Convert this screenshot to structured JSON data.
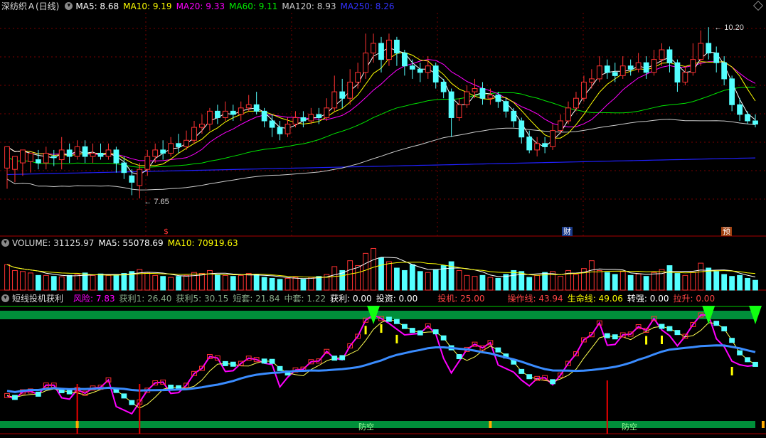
{
  "main_header": {
    "stock": "深纺织Ａ(日线)",
    "ma5": "MA5: 8.68",
    "ma10": "MA10: 9.19",
    "ma20": "MA20: 9.33",
    "ma60": "MA60: 9.11",
    "ma120": "MA120: 8.93",
    "ma250": "MA250: 8.26"
  },
  "vol_header": {
    "vol": "VOLUME: 31125.97",
    "ma5": "MA5: 55078.69",
    "ma10": "MA10: 70919.63"
  },
  "ind_header": {
    "name": "短线投机获利",
    "risk": "风险: 7.83",
    "p1": "获利1: 26.40",
    "p5": "获利5: 30.15",
    "short": "短套: 21.84",
    "mid": "中套: 1.22",
    "profit": "获利: 0.00",
    "invest": "投资: 0.00",
    "spec": "投机: 25.00",
    "op": "操作线: 43.94",
    "life": "生命线: 49.06",
    "turn": "转强: 0.00",
    "pull": "拉升: 0.00"
  },
  "markers": {
    "s": "$",
    "cai": "财",
    "yu": "预"
  },
  "bottom_labels": {
    "l1": "防空",
    "l2": "防空"
  },
  "colors": {
    "up": "#ff3232",
    "down": "#54ffff",
    "ma5": "#ffffff",
    "ma10": "#ffff00",
    "ma20": "#ff00ff",
    "ma60": "#00e600",
    "ma120": "#cccccc",
    "ma250": "#2020ff",
    "op": "#ffff50",
    "life": "#3a8cff",
    "risk": "#ff00ff",
    "green_bar": "#008f3a"
  },
  "chart_data": {
    "type": "candlestick",
    "ylim": [
      7.2,
      10.5
    ],
    "high_label": "10.20",
    "low_label": "7.65",
    "candles": [
      [
        8.12,
        8.45,
        8.35,
        7.8
      ],
      [
        8.1,
        8.3,
        8.2,
        7.9
      ],
      [
        8.2,
        8.4,
        8.3,
        8.0
      ],
      [
        8.22,
        8.35,
        8.3,
        8.05
      ],
      [
        8.25,
        8.2,
        8.4,
        8.1
      ],
      [
        8.2,
        8.35,
        8.45,
        8.1
      ],
      [
        8.3,
        8.28,
        8.4,
        8.15
      ],
      [
        8.25,
        8.4,
        8.6,
        8.1
      ],
      [
        8.4,
        8.3,
        8.5,
        8.2
      ],
      [
        8.3,
        8.45,
        8.55,
        8.25
      ],
      [
        8.45,
        8.3,
        8.55,
        8.2
      ],
      [
        8.3,
        8.35,
        8.5,
        8.2
      ],
      [
        8.35,
        8.3,
        8.5,
        8.25
      ],
      [
        8.3,
        8.4,
        8.5,
        8.25
      ],
      [
        8.4,
        8.2,
        8.45,
        8.05
      ],
      [
        8.2,
        8.05,
        8.3,
        7.95
      ],
      [
        8.0,
        7.9,
        8.1,
        7.7
      ],
      [
        7.85,
        8.1,
        8.2,
        7.65
      ],
      [
        8.1,
        8.3,
        8.4,
        8.0
      ],
      [
        8.3,
        8.4,
        8.5,
        8.2
      ],
      [
        8.4,
        8.35,
        8.55,
        8.25
      ],
      [
        8.35,
        8.5,
        8.6,
        8.3
      ],
      [
        8.5,
        8.45,
        8.65,
        8.35
      ],
      [
        8.45,
        8.55,
        8.7,
        8.4
      ],
      [
        8.55,
        8.75,
        8.85,
        8.5
      ],
      [
        8.75,
        8.8,
        8.95,
        8.65
      ],
      [
        8.8,
        9.0,
        9.05,
        8.7
      ],
      [
        9.0,
        8.9,
        9.1,
        8.8
      ],
      [
        8.9,
        9.0,
        9.15,
        8.85
      ],
      [
        9.0,
        8.95,
        9.1,
        8.85
      ],
      [
        8.95,
        9.05,
        9.15,
        8.85
      ],
      [
        9.05,
        9.1,
        9.25,
        9.0
      ],
      [
        9.1,
        9.0,
        9.3,
        8.95
      ],
      [
        9.0,
        8.85,
        9.05,
        8.75
      ],
      [
        8.85,
        8.75,
        8.95,
        8.6
      ],
      [
        8.75,
        8.65,
        8.85,
        8.55
      ],
      [
        8.65,
        8.8,
        8.9,
        8.6
      ],
      [
        8.8,
        8.9,
        9.0,
        8.75
      ],
      [
        8.9,
        8.85,
        9.0,
        8.75
      ],
      [
        8.85,
        8.95,
        9.05,
        8.8
      ],
      [
        8.95,
        8.9,
        9.05,
        8.8
      ],
      [
        8.9,
        9.05,
        9.2,
        8.85
      ],
      [
        9.05,
        9.3,
        9.55,
        9.0
      ],
      [
        9.3,
        9.2,
        9.5,
        9.05
      ],
      [
        9.2,
        9.45,
        9.65,
        9.1
      ],
      [
        9.45,
        9.6,
        9.75,
        9.35
      ],
      [
        9.6,
        9.9,
        10.2,
        9.5
      ],
      [
        9.9,
        10.05,
        10.2,
        9.75
      ],
      [
        10.05,
        9.8,
        10.15,
        9.6
      ],
      [
        9.8,
        10.1,
        10.2,
        9.7
      ],
      [
        10.1,
        9.9,
        10.15,
        9.7
      ],
      [
        9.9,
        9.7,
        9.95,
        9.55
      ],
      [
        9.7,
        9.65,
        9.8,
        9.5
      ],
      [
        9.65,
        9.6,
        9.75,
        9.45
      ],
      [
        9.6,
        9.7,
        9.85,
        9.5
      ],
      [
        9.7,
        9.45,
        9.75,
        9.35
      ],
      [
        9.45,
        9.3,
        9.5,
        9.2
      ],
      [
        9.3,
        8.9,
        9.35,
        8.6
      ],
      [
        8.9,
        9.1,
        9.2,
        8.85
      ],
      [
        9.1,
        9.3,
        9.4,
        9.05
      ],
      [
        9.3,
        9.35,
        9.5,
        9.2
      ],
      [
        9.35,
        9.2,
        9.45,
        9.1
      ],
      [
        9.2,
        9.25,
        9.35,
        9.1
      ],
      [
        9.25,
        9.15,
        9.3,
        9.05
      ],
      [
        9.15,
        9.0,
        9.2,
        8.9
      ],
      [
        9.0,
        8.85,
        9.05,
        8.75
      ],
      [
        8.85,
        8.6,
        8.9,
        8.5
      ],
      [
        8.6,
        8.4,
        8.7,
        8.35
      ],
      [
        8.4,
        8.5,
        8.6,
        8.3
      ],
      [
        8.5,
        8.45,
        8.6,
        8.35
      ],
      [
        8.45,
        8.7,
        8.8,
        8.4
      ],
      [
        8.7,
        8.85,
        8.95,
        8.65
      ],
      [
        8.85,
        9.05,
        9.15,
        8.8
      ],
      [
        9.05,
        9.2,
        9.3,
        9.0
      ],
      [
        9.2,
        9.45,
        9.55,
        9.15
      ],
      [
        9.45,
        9.5,
        9.65,
        9.35
      ],
      [
        9.5,
        9.7,
        9.85,
        9.45
      ],
      [
        9.7,
        9.6,
        9.8,
        9.5
      ],
      [
        9.6,
        9.55,
        9.75,
        9.45
      ],
      [
        9.55,
        9.7,
        9.85,
        9.5
      ],
      [
        9.7,
        9.65,
        9.8,
        9.55
      ],
      [
        9.65,
        9.75,
        9.9,
        9.6
      ],
      [
        9.75,
        9.6,
        9.85,
        9.5
      ],
      [
        9.6,
        9.8,
        9.95,
        9.55
      ],
      [
        9.8,
        9.95,
        10.05,
        9.7
      ],
      [
        9.95,
        9.75,
        10.0,
        9.6
      ],
      [
        9.75,
        9.45,
        9.8,
        9.3
      ],
      [
        9.45,
        9.6,
        9.7,
        9.4
      ],
      [
        9.6,
        9.8,
        10.05,
        9.55
      ],
      [
        9.8,
        10.05,
        10.25,
        9.7
      ],
      [
        10.05,
        9.9,
        10.3,
        9.8
      ],
      [
        9.9,
        9.75,
        10.0,
        9.6
      ],
      [
        9.75,
        9.5,
        9.85,
        9.4
      ],
      [
        9.5,
        9.1,
        9.55,
        9.0
      ],
      [
        9.1,
        8.95,
        9.2,
        8.85
      ],
      [
        8.95,
        8.85,
        9.0,
        8.8
      ],
      [
        8.85,
        8.8,
        8.95,
        8.75
      ]
    ],
    "volume": [
      52,
      40,
      38,
      35,
      30,
      30,
      28,
      27,
      30,
      32,
      35,
      30,
      33,
      30,
      32,
      34,
      38,
      42,
      36,
      30,
      28,
      26,
      28,
      30,
      36,
      34,
      40,
      32,
      30,
      28,
      30,
      34,
      32,
      26,
      24,
      22,
      24,
      26,
      22,
      26,
      28,
      32,
      48,
      40,
      60,
      50,
      75,
      85,
      66,
      58,
      45,
      40,
      52,
      38,
      36,
      42,
      50,
      58,
      40,
      30,
      28,
      30,
      26,
      24,
      32,
      40,
      38,
      26,
      30,
      36,
      38,
      28,
      40,
      32,
      44,
      60,
      40,
      36,
      32,
      38,
      30,
      33,
      28,
      36,
      42,
      50,
      34,
      30,
      36,
      55,
      45,
      38,
      32,
      28,
      30,
      24,
      20
    ]
  }
}
